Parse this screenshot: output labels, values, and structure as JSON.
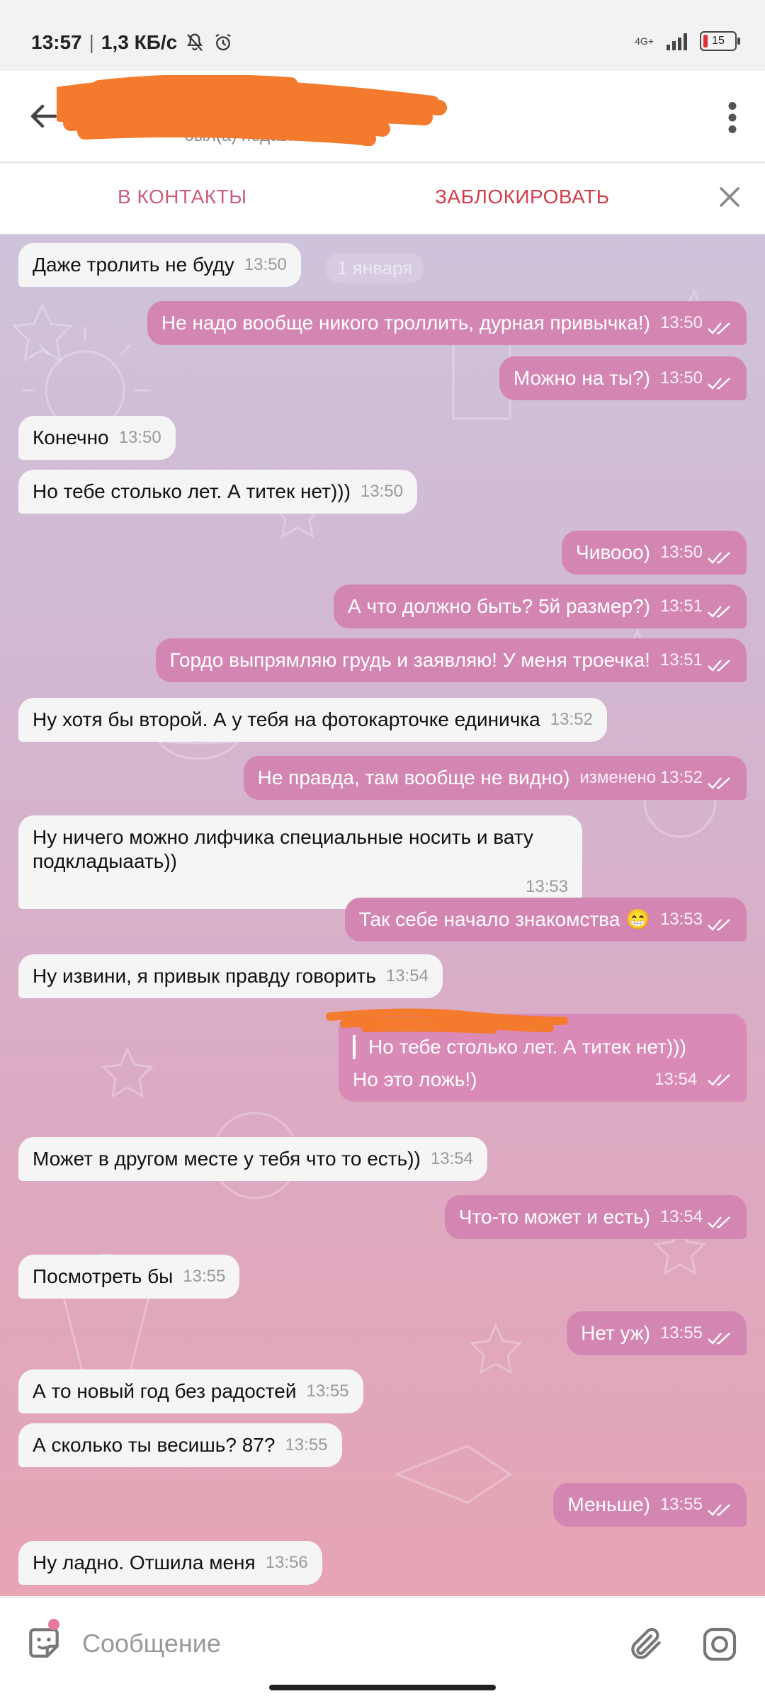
{
  "status": {
    "time": "13:57",
    "speed": "1,3 КБ/с",
    "network": "4G+",
    "battery": "15"
  },
  "header": {
    "name": "",
    "subtitle": "был(а) недавно"
  },
  "actions": {
    "add_contact": "В КОНТАКТЫ",
    "block": "ЗАБЛОКИРОВАТЬ"
  },
  "date_pill": "1 января",
  "messages": [
    {
      "dir": "in",
      "text": "Даже тролить не буду",
      "time": "13:50"
    },
    {
      "dir": "out",
      "text": "Не надо вообще никого троллить, дурная привычка!)",
      "time": "13:50"
    },
    {
      "dir": "out",
      "text": "Можно на ты?)",
      "time": "13:50"
    },
    {
      "dir": "in",
      "text": "Конечно",
      "time": "13:50"
    },
    {
      "dir": "in",
      "text": "Но тебе столько лет. А титек нет)))",
      "time": "13:50"
    },
    {
      "dir": "out",
      "text": "Чивооо)",
      "time": "13:50"
    },
    {
      "dir": "out",
      "text": "А что должно быть? 5й размер?)",
      "time": "13:51"
    },
    {
      "dir": "out",
      "text": "Гордо выпрямляю грудь и заявляю! У меня троечка!",
      "time": "13:51"
    },
    {
      "dir": "in",
      "text": "Ну хотя бы второй. А у тебя на фотокарточке единичка",
      "time": "13:52"
    },
    {
      "dir": "out",
      "text": "Не правда, там вообще не видно)",
      "time": "13:52",
      "edited": "изменено"
    },
    {
      "dir": "in",
      "text": "Ну ничего можно лифчика специальные носить и вату подкладыаать))",
      "time": "13:53"
    },
    {
      "dir": "out",
      "text": "Так себе начало знакомства 😁",
      "time": "13:53"
    },
    {
      "dir": "in",
      "text": "Ну извини, я привык правду говорить",
      "time": "13:54"
    },
    {
      "dir": "out",
      "quote": "Но тебе столько лет. А титек нет)))",
      "text": "Но это ложь!)",
      "time": "13:54"
    },
    {
      "dir": "in",
      "text": "Может в другом месте у тебя что то есть))",
      "time": "13:54"
    },
    {
      "dir": "out",
      "text": "Что-то может и есть)",
      "time": "13:54"
    },
    {
      "dir": "in",
      "text": "Посмотреть бы",
      "time": "13:55"
    },
    {
      "dir": "out",
      "text": "Нет уж)",
      "time": "13:55"
    },
    {
      "dir": "in",
      "text": "А то новый год без радостей",
      "time": "13:55"
    },
    {
      "dir": "in",
      "text": "А сколько ты весишь? 87?",
      "time": "13:55"
    },
    {
      "dir": "out",
      "text": "Меньше)",
      "time": "13:55"
    },
    {
      "dir": "in",
      "text": "Ну ладно. Отшила меня",
      "time": "13:56"
    }
  ],
  "composer": {
    "placeholder": "Сообщение"
  }
}
